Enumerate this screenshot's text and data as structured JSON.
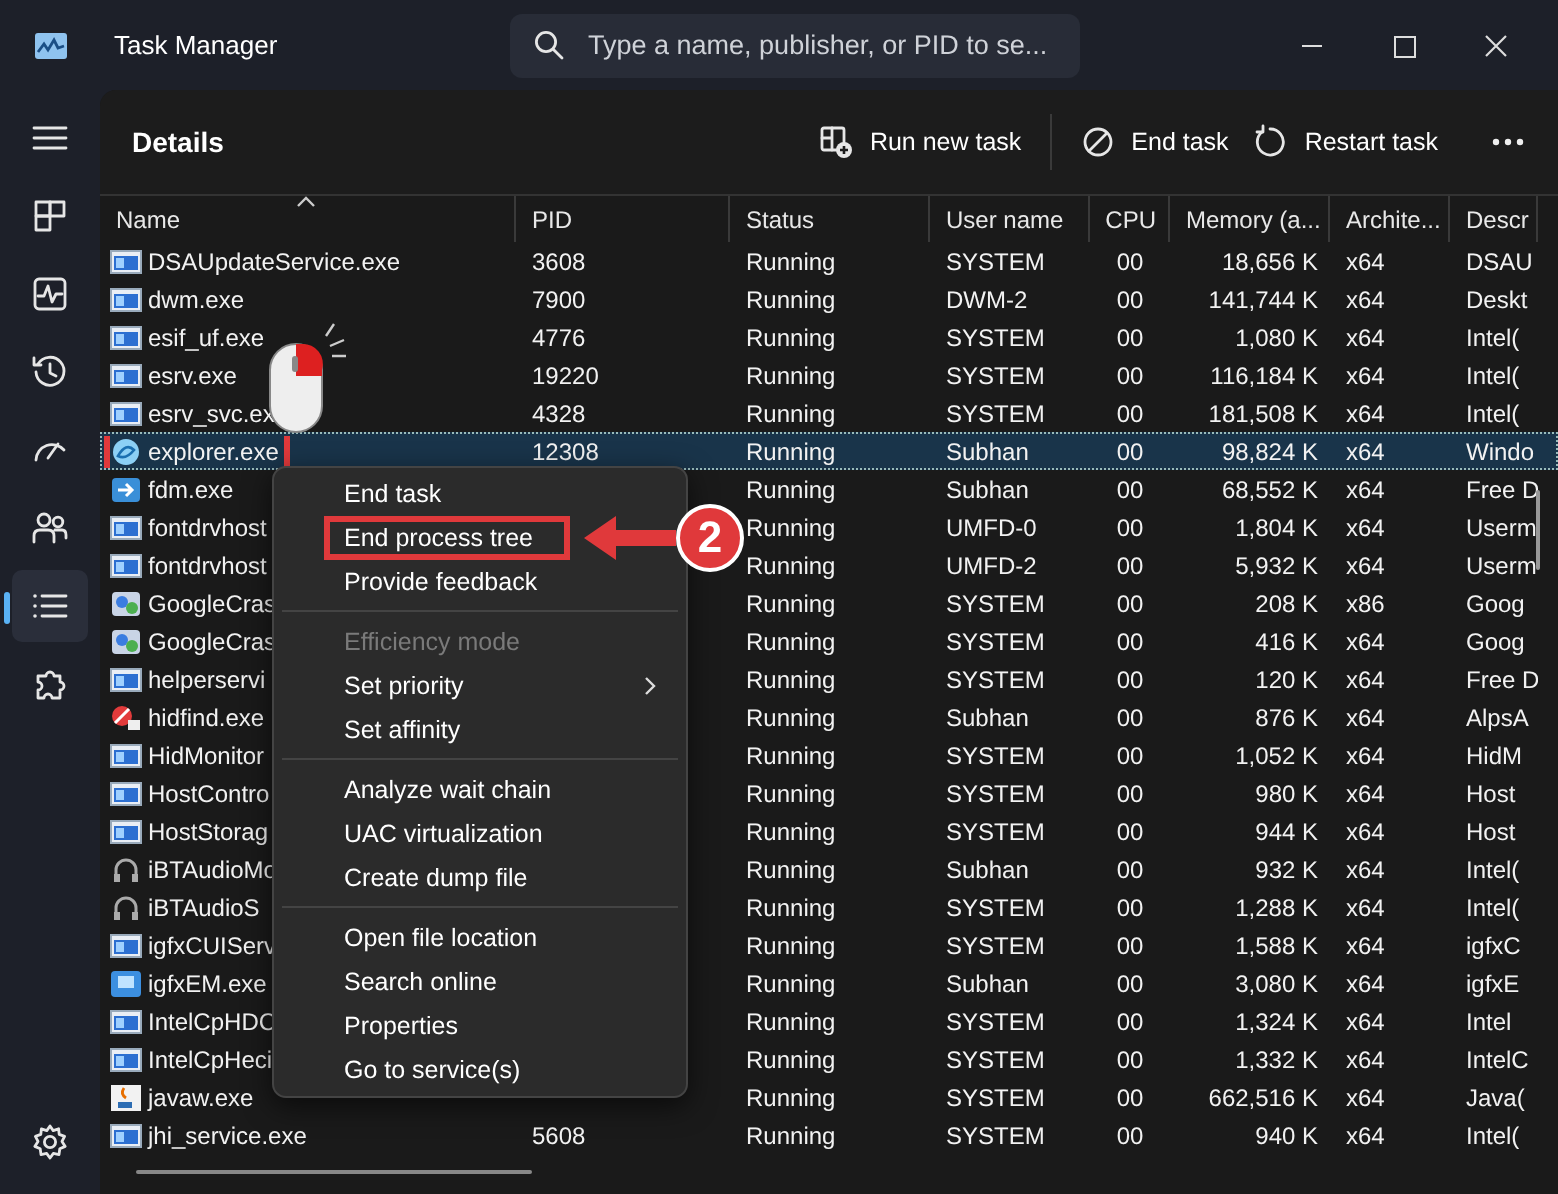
{
  "window": {
    "title": "Task Manager"
  },
  "search": {
    "placeholder": "Type a name, publisher, or PID to se..."
  },
  "nav": [
    {
      "kind": "menu",
      "selected": false
    },
    {
      "kind": "processes",
      "selected": false
    },
    {
      "kind": "performance",
      "selected": false
    },
    {
      "kind": "history",
      "selected": false
    },
    {
      "kind": "startup",
      "selected": false
    },
    {
      "kind": "users",
      "selected": false
    },
    {
      "kind": "details",
      "selected": true
    },
    {
      "kind": "services",
      "selected": false
    },
    {
      "kind": "settings",
      "selected": false
    }
  ],
  "page": {
    "title": "Details"
  },
  "toolbar": [
    {
      "kind": "run",
      "label": "Run new task"
    },
    {
      "kind": "end",
      "label": "End task"
    },
    {
      "kind": "restart",
      "label": "Restart task"
    },
    {
      "kind": "more"
    }
  ],
  "table": {
    "columns": [
      {
        "label": "Name",
        "sorted": true
      },
      {
        "label": "PID"
      },
      {
        "label": "Status"
      },
      {
        "label": "User name"
      },
      {
        "label": "CPU"
      },
      {
        "label": "Memory (a..."
      },
      {
        "label": "Archite..."
      },
      {
        "label": "Descr"
      }
    ],
    "rows": [
      {
        "kind": "app",
        "name": "DSAUpdateService.exe",
        "pid": "3608",
        "status": "Running",
        "user": "SYSTEM",
        "cpu": "00",
        "memory": "18,656 K",
        "arch": "x64",
        "description": "DSAU",
        "selected": false
      },
      {
        "kind": "app",
        "name": "dwm.exe",
        "pid": "7900",
        "status": "Running",
        "user": "DWM-2",
        "cpu": "00",
        "memory": "141,744 K",
        "arch": "x64",
        "description": "Deskt",
        "selected": false
      },
      {
        "kind": "app",
        "name": "esif_uf.exe",
        "pid": "4776",
        "status": "Running",
        "user": "SYSTEM",
        "cpu": "00",
        "memory": "1,080 K",
        "arch": "x64",
        "description": "Intel(",
        "selected": false
      },
      {
        "kind": "app",
        "name": "esrv.exe",
        "pid": "19220",
        "status": "Running",
        "user": "SYSTEM",
        "cpu": "00",
        "memory": "116,184 K",
        "arch": "x64",
        "description": "Intel(",
        "selected": false
      },
      {
        "kind": "app",
        "name": "esrv_svc.ex",
        "pid": "4328",
        "status": "Running",
        "user": "SYSTEM",
        "cpu": "00",
        "memory": "181,508 K",
        "arch": "x64",
        "description": "Intel(",
        "selected": false
      },
      {
        "kind": "explorer",
        "name": "explorer.exe",
        "pid": "12308",
        "status": "Running",
        "user": "Subhan",
        "cpu": "00",
        "memory": "98,824 K",
        "arch": "x64",
        "description": "Windo",
        "selected": true,
        "callout": true
      },
      {
        "kind": "download",
        "name": "fdm.exe",
        "status": "Running",
        "user": "Subhan",
        "cpu": "00",
        "memory": "68,552 K",
        "arch": "x64",
        "description": "Free D",
        "selected": false
      },
      {
        "kind": "app",
        "name": "fontdrvhost",
        "status": "Running",
        "user": "UMFD-0",
        "cpu": "00",
        "memory": "1,804 K",
        "arch": "x64",
        "description": "Userm",
        "selected": false
      },
      {
        "kind": "app",
        "name": "fontdrvhost",
        "status": "Running",
        "user": "UMFD-2",
        "cpu": "00",
        "memory": "5,932 K",
        "arch": "x64",
        "description": "Userm",
        "selected": false
      },
      {
        "kind": "setup",
        "name": "GoogleCras",
        "status": "Running",
        "user": "SYSTEM",
        "cpu": "00",
        "memory": "208 K",
        "arch": "x86",
        "description": "Goog",
        "selected": false
      },
      {
        "kind": "setup",
        "name": "GoogleCras",
        "status": "Running",
        "user": "SYSTEM",
        "cpu": "00",
        "memory": "416 K",
        "arch": "x64",
        "description": "Goog",
        "selected": false
      },
      {
        "kind": "app",
        "name": "helperservi",
        "status": "Running",
        "user": "SYSTEM",
        "cpu": "00",
        "memory": "120 K",
        "arch": "x64",
        "description": "Free D",
        "selected": false
      },
      {
        "kind": "blocked",
        "name": "hidfind.exe",
        "status": "Running",
        "user": "Subhan",
        "cpu": "00",
        "memory": "876 K",
        "arch": "x64",
        "description": "AlpsA",
        "selected": false
      },
      {
        "kind": "app",
        "name": "HidMonitor",
        "status": "Running",
        "user": "SYSTEM",
        "cpu": "00",
        "memory": "1,052 K",
        "arch": "x64",
        "description": "HidM",
        "selected": false
      },
      {
        "kind": "app",
        "name": "HostContro",
        "status": "Running",
        "user": "SYSTEM",
        "cpu": "00",
        "memory": "980 K",
        "arch": "x64",
        "description": "Host",
        "selected": false
      },
      {
        "kind": "app",
        "name": "HostStorag",
        "status": "Running",
        "user": "SYSTEM",
        "cpu": "00",
        "memory": "944 K",
        "arch": "x64",
        "description": "Host",
        "selected": false
      },
      {
        "kind": "headphones",
        "name": "iBTAudioMo",
        "status": "Running",
        "user": "Subhan",
        "cpu": "00",
        "memory": "932 K",
        "arch": "x64",
        "description": "Intel(",
        "selected": false
      },
      {
        "kind": "headphones",
        "name": "iBTAudioS",
        "status": "Running",
        "user": "SYSTEM",
        "cpu": "00",
        "memory": "1,288 K",
        "arch": "x64",
        "description": "Intel(",
        "selected": false
      },
      {
        "kind": "app",
        "name": "igfxCUIServ",
        "status": "Running",
        "user": "SYSTEM",
        "cpu": "00",
        "memory": "1,588 K",
        "arch": "x64",
        "description": "igfxC",
        "selected": false
      },
      {
        "kind": "graphics",
        "name": "igfxEM.exe",
        "status": "Running",
        "user": "Subhan",
        "cpu": "00",
        "memory": "3,080 K",
        "arch": "x64",
        "description": "igfxE",
        "selected": false
      },
      {
        "kind": "app",
        "name": "IntelCpHDC",
        "status": "Running",
        "user": "SYSTEM",
        "cpu": "00",
        "memory": "1,324 K",
        "arch": "x64",
        "description": "Intel",
        "selected": false
      },
      {
        "kind": "app",
        "name": "IntelCpHeci",
        "status": "Running",
        "user": "SYSTEM",
        "cpu": "00",
        "memory": "1,332 K",
        "arch": "x64",
        "description": "IntelC",
        "selected": false
      },
      {
        "kind": "java",
        "name": "javaw.exe",
        "status": "Running",
        "user": "SYSTEM",
        "cpu": "00",
        "memory": "662,516 K",
        "arch": "x64",
        "description": "Java(",
        "selected": false
      },
      {
        "kind": "app",
        "name": "jhi_service.exe",
        "pid": "5608",
        "status": "Running",
        "user": "SYSTEM",
        "cpu": "00",
        "memory": "940 K",
        "arch": "x64",
        "description": "Intel(",
        "selected": false
      }
    ]
  },
  "context_menu": {
    "groups": [
      [
        {
          "label": "End task",
          "disabled": false
        },
        {
          "label": "End process tree",
          "disabled": false,
          "callout": true
        },
        {
          "label": "Provide feedback",
          "disabled": false
        }
      ],
      [
        {
          "label": "Efficiency mode",
          "disabled": true
        },
        {
          "label": "Set priority",
          "disabled": false,
          "submenu": true
        },
        {
          "label": "Set affinity",
          "disabled": false
        }
      ],
      [
        {
          "label": "Analyze wait chain",
          "disabled": false
        },
        {
          "label": "UAC virtualization",
          "disabled": false
        },
        {
          "label": "Create dump file",
          "disabled": false
        }
      ],
      [
        {
          "label": "Open file location",
          "disabled": false
        },
        {
          "label": "Search online",
          "disabled": false
        },
        {
          "label": "Properties",
          "disabled": false
        },
        {
          "label": "Go to service(s)",
          "disabled": false
        }
      ]
    ]
  },
  "annotation": {
    "step": "2"
  }
}
